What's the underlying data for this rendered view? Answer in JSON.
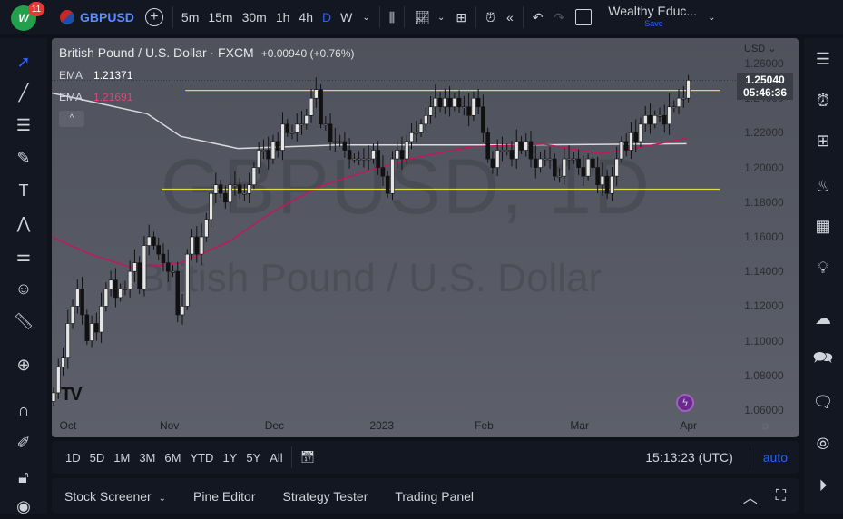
{
  "header": {
    "notifications": "11",
    "avatar_text": "W",
    "symbol": "GBPUSD",
    "intervals": [
      "5m",
      "15m",
      "30m",
      "1h",
      "4h",
      "D",
      "W"
    ],
    "active_interval": "D",
    "layout_name": "Wealthy Educ...",
    "save_label": "Save"
  },
  "legend": {
    "title": "British Pound / U.S. Dollar · FXCM",
    "change": "+0.00940 (+0.76%)",
    "ema1_label": "EMA",
    "ema1_value": "1.21371",
    "ema2_label": "EMA",
    "ema2_value": "1.21691",
    "currency": "USD"
  },
  "watermark": {
    "line1": "GBPUSD, 1D",
    "line2": "British Pound / U.S. Dollar"
  },
  "price_tag": {
    "price": "1.25040",
    "countdown": "05:46:36"
  },
  "colors": {
    "ema_fast": "#c2185b",
    "ema_slow": "#d9d9dc",
    "level_line": "#e6d84a",
    "accent": "#2962ff"
  },
  "bottom": {
    "ranges": [
      "1D",
      "5D",
      "1M",
      "3M",
      "6M",
      "YTD",
      "1Y",
      "5Y",
      "All"
    ],
    "clock": "15:13:23 (UTC)",
    "auto_label": "auto"
  },
  "panel_tabs": [
    "Stock Screener",
    "Pine Editor",
    "Strategy Tester",
    "Trading Panel"
  ],
  "chart_data": {
    "type": "candlestick",
    "symbol": "GBPUSD",
    "timeframe": "1D",
    "ylim": [
      1.05,
      1.265
    ],
    "y_ticks": [
      "1.26000",
      "1.24000",
      "1.22000",
      "1.20000",
      "1.18000",
      "1.16000",
      "1.14000",
      "1.12000",
      "1.10000",
      "1.08000",
      "1.06000"
    ],
    "x_ticks": [
      {
        "label": "Oct",
        "index": 2
      },
      {
        "label": "Nov",
        "index": 23
      },
      {
        "label": "Dec",
        "index": 45
      },
      {
        "label": "2023",
        "index": 67
      },
      {
        "label": "Feb",
        "index": 89
      },
      {
        "label": "Mar",
        "index": 109
      },
      {
        "label": "Apr",
        "index": 132
      }
    ],
    "closes": [
      1.07,
      1.085,
      1.09,
      1.11,
      1.12,
      1.13,
      1.115,
      1.1,
      1.11,
      1.105,
      1.12,
      1.13,
      1.135,
      1.125,
      1.13,
      1.13,
      1.14,
      1.145,
      1.13,
      1.155,
      1.16,
      1.155,
      1.15,
      1.145,
      1.14,
      1.14,
      1.115,
      1.12,
      1.15,
      1.16,
      1.15,
      1.16,
      1.17,
      1.185,
      1.19,
      1.185,
      1.18,
      1.19,
      1.19,
      1.185,
      1.185,
      1.19,
      1.2,
      1.21,
      1.21,
      1.205,
      1.215,
      1.21,
      1.225,
      1.22,
      1.22,
      1.225,
      1.225,
      1.23,
      1.24,
      1.245,
      1.225,
      1.225,
      1.215,
      1.215,
      1.215,
      1.21,
      1.205,
      1.205,
      1.205,
      1.205,
      1.205,
      1.21,
      1.2,
      1.195,
      1.185,
      1.205,
      1.21,
      1.205,
      1.215,
      1.22,
      1.22,
      1.225,
      1.23,
      1.235,
      1.24,
      1.235,
      1.24,
      1.235,
      1.24,
      1.235,
      1.235,
      1.23,
      1.24,
      1.235,
      1.22,
      1.205,
      1.2,
      1.21,
      1.21,
      1.21,
      1.205,
      1.215,
      1.21,
      1.215,
      1.205,
      1.2,
      1.205,
      1.205,
      1.205,
      1.195,
      1.195,
      1.205,
      1.205,
      1.205,
      1.2,
      1.195,
      1.205,
      1.2,
      1.19,
      1.195,
      1.185,
      1.195,
      1.205,
      1.215,
      1.21,
      1.22,
      1.215,
      1.225,
      1.23,
      1.225,
      1.23,
      1.23,
      1.225,
      1.235,
      1.235,
      1.24,
      1.24,
      1.2504
    ],
    "ema_slow": [
      [
        0,
        1.243
      ],
      [
        20,
        1.231
      ],
      [
        27,
        1.218
      ],
      [
        39,
        1.211
      ],
      [
        60,
        1.213
      ],
      [
        100,
        1.213
      ],
      [
        133,
        1.2137
      ]
    ],
    "ema_fast": [
      [
        0,
        1.16
      ],
      [
        8,
        1.15
      ],
      [
        17,
        1.142
      ],
      [
        27,
        1.145
      ],
      [
        37,
        1.157
      ],
      [
        46,
        1.174
      ],
      [
        56,
        1.189
      ],
      [
        65,
        1.197
      ],
      [
        75,
        1.205
      ],
      [
        88,
        1.212
      ],
      [
        103,
        1.2135
      ],
      [
        115,
        1.208
      ],
      [
        126,
        1.213
      ],
      [
        133,
        1.2169
      ]
    ],
    "levels": [
      {
        "price": 1.2445,
        "from_index": 28,
        "to_index": 140
      },
      {
        "price": 1.1875,
        "from_index": 23,
        "to_index": 140
      }
    ]
  }
}
